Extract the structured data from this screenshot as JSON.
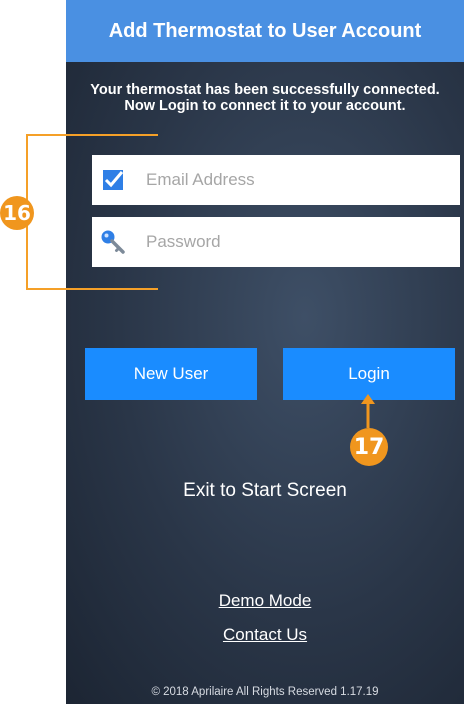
{
  "header": {
    "title": "Add Thermostat to User Account"
  },
  "message": {
    "line1": "Your thermostat has been successfully connected.",
    "line2": "Now Login to connect it to your account."
  },
  "form": {
    "email_placeholder": "Email Address",
    "password_placeholder": "Password"
  },
  "buttons": {
    "new_user": "New User",
    "login": "Login"
  },
  "exit_label": "Exit to Start Screen",
  "links": {
    "demo_mode": "Demo Mode",
    "contact_us": "Contact Us"
  },
  "footer": {
    "copyright": "© 2018 Aprilaire All Rights Reserved 1.17.19"
  },
  "callouts": {
    "fields": "16",
    "login": "17"
  },
  "colors": {
    "header_bg": "#4a90e2",
    "button_bg": "#1a8cff",
    "callout": "#f0961e",
    "email_icon": "#2f7fe6"
  },
  "icons": {
    "email": "checkbox-check-icon",
    "password": "key-icon"
  }
}
